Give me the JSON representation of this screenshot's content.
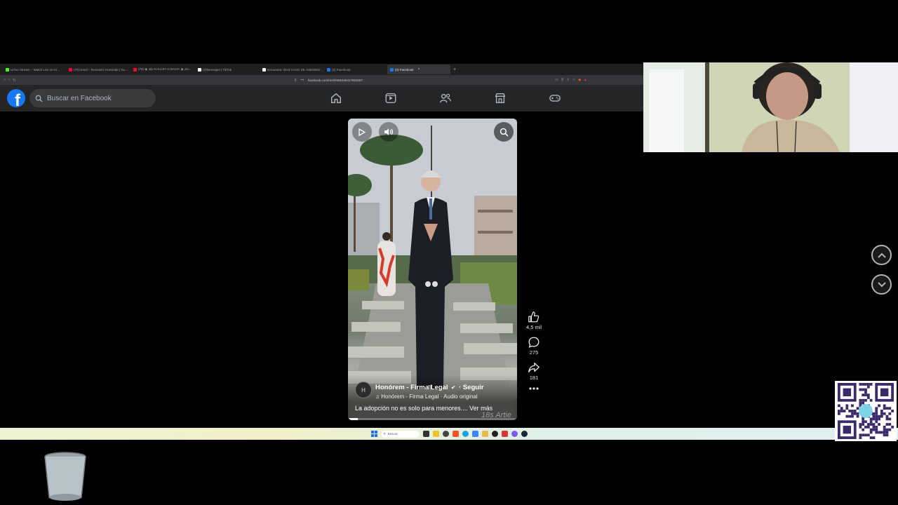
{
  "browser": {
    "tabs": [
      {
        "label": "Uchu! Stream – Watch Live on Ki…",
        "color": "#53fc18"
      },
      {
        "label": "(70) D4vd – Romantic Homicide | Su…",
        "color": "#ff0033"
      },
      {
        "label": "(78) ◉ ¡BLACKLIST is BACK! ◉ ¡Ev…",
        "color": "#ff0033"
      },
      {
        "label": "(2)Mensajes | TikTok",
        "color": "#ffffff"
      },
      {
        "label": "Encuentra 'd4vd CASO DE ASESINO'…",
        "color": "#ffffff"
      },
      {
        "label": "(2) Facebook",
        "color": "#1877f2"
      },
      {
        "label": "(2) Facebook",
        "color": "#1877f2",
        "active": true
      }
    ],
    "url": "facebook.com/reel/2591645417853057",
    "new_tab": "+",
    "close_tab": "×"
  },
  "facebook": {
    "logo": "f",
    "search_placeholder": "Buscar en Facebook",
    "nav": [
      "home-icon",
      "video-icon",
      "friends-icon",
      "marketplace-icon",
      "gaming-icon"
    ]
  },
  "reel": {
    "author": "Honórem - Firma Legal",
    "verified": true,
    "follow": "· Seguir",
    "audio": "Honórem - Firma Legal · Audio original",
    "caption": "La adopción no es solo para menores.... Ver más",
    "watermark": "18s Artie",
    "avatar_text": "H",
    "progress": 0.06
  },
  "actions": {
    "likes": "4,5 mil",
    "comments": "275",
    "shares": "181"
  },
  "taskbar": {
    "search_label": "Buscar"
  },
  "colors": {
    "fb_blue": "#1877f2",
    "header_bg": "#242526",
    "search_bg": "#3a3b3c"
  }
}
